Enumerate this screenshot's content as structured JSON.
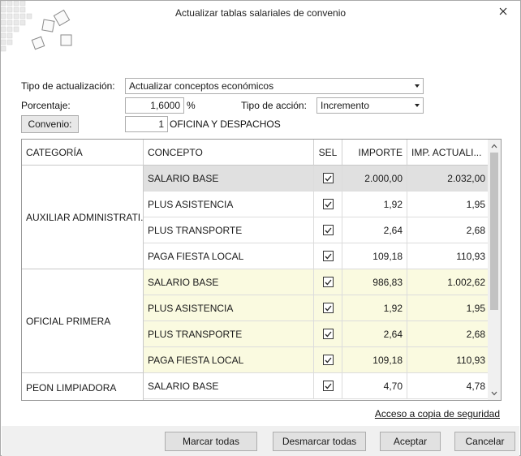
{
  "window": {
    "title": "Actualizar tablas salariales de convenio"
  },
  "form": {
    "tipo_actualizacion_label": "Tipo de actualización:",
    "tipo_actualizacion_value": "Actualizar conceptos económicos",
    "porcentaje_label": "Porcentaje:",
    "porcentaje_value": "1,6000",
    "porcentaje_unit": "%",
    "tipo_accion_label": "Tipo de acción:",
    "tipo_accion_value": "Incremento",
    "convenio_button": "Convenio:",
    "convenio_code": "1",
    "convenio_name": "OFICINA Y DESPACHOS"
  },
  "grid": {
    "headers": {
      "categoria": "CATEGORÍA",
      "concepto": "CONCEPTO",
      "sel": "SEL",
      "importe": "IMPORTE",
      "imp_actual": "IMP. ACTUALI..."
    },
    "categories": [
      "AUXILIAR ADMINISTRATI...",
      "OFICIAL PRIMERA",
      "PEON LIMPIADORA"
    ],
    "rows": [
      {
        "concepto": "SALARIO BASE",
        "sel": true,
        "importe": "2.000,00",
        "imp_actual": "2.032,00"
      },
      {
        "concepto": "PLUS ASISTENCIA",
        "sel": true,
        "importe": "1,92",
        "imp_actual": "1,95"
      },
      {
        "concepto": "PLUS TRANSPORTE",
        "sel": true,
        "importe": "2,64",
        "imp_actual": "2,68"
      },
      {
        "concepto": "PAGA FIESTA LOCAL",
        "sel": true,
        "importe": "109,18",
        "imp_actual": "110,93"
      },
      {
        "concepto": "SALARIO BASE",
        "sel": true,
        "importe": "986,83",
        "imp_actual": "1.002,62"
      },
      {
        "concepto": "PLUS ASISTENCIA",
        "sel": true,
        "importe": "1,92",
        "imp_actual": "1,95"
      },
      {
        "concepto": "PLUS TRANSPORTE",
        "sel": true,
        "importe": "2,64",
        "imp_actual": "2,68"
      },
      {
        "concepto": "PAGA FIESTA LOCAL",
        "sel": true,
        "importe": "109,18",
        "imp_actual": "110,93"
      },
      {
        "concepto": "SALARIO BASE",
        "sel": true,
        "importe": "4,70",
        "imp_actual": "4,78"
      }
    ]
  },
  "link_backup": "Acceso a copia de seguridad",
  "buttons": {
    "marcar_todas": "Marcar todas",
    "desmarcar_todas": "Desmarcar todas",
    "aceptar": "Aceptar",
    "cancelar": "Cancelar"
  },
  "colors": {
    "selected_row": "#e0e0e0",
    "highlight_row": "#fafae0",
    "footer": "#f0f0f0"
  }
}
